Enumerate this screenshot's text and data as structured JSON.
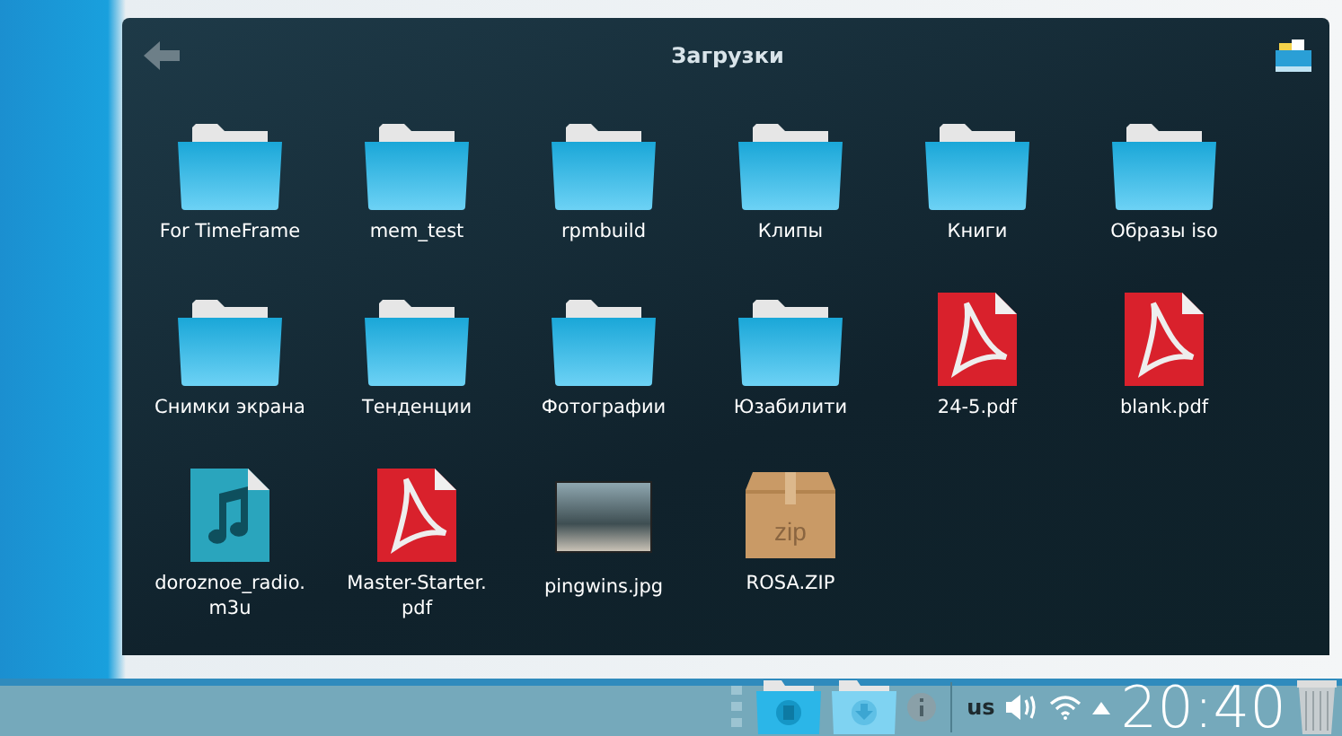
{
  "window": {
    "title": "Загрузки"
  },
  "items": [
    {
      "kind": "folder",
      "name": "For TimeFrame"
    },
    {
      "kind": "folder",
      "name": "mem_test"
    },
    {
      "kind": "folder",
      "name": "rpmbuild"
    },
    {
      "kind": "folder",
      "name": "Клипы"
    },
    {
      "kind": "folder",
      "name": "Книги"
    },
    {
      "kind": "folder",
      "name": "Образы iso"
    },
    {
      "kind": "folder",
      "name": "Снимки экрана"
    },
    {
      "kind": "folder",
      "name": "Тенденции"
    },
    {
      "kind": "folder",
      "name": "Фотографии"
    },
    {
      "kind": "folder",
      "name": "Юзабилити"
    },
    {
      "kind": "pdf",
      "name": "24-5.pdf"
    },
    {
      "kind": "pdf",
      "name": "blank.pdf"
    },
    {
      "kind": "audio",
      "name": "doroznoe_radio.\nm3u"
    },
    {
      "kind": "pdf",
      "name": "Master-Starter.\npdf"
    },
    {
      "kind": "image",
      "name": "pingwins.jpg"
    },
    {
      "kind": "archive",
      "name": "ROSA.ZIP",
      "icon_text": "zip"
    }
  ],
  "taskbar": {
    "keyboard_layout": "us",
    "clock": "20:40"
  }
}
